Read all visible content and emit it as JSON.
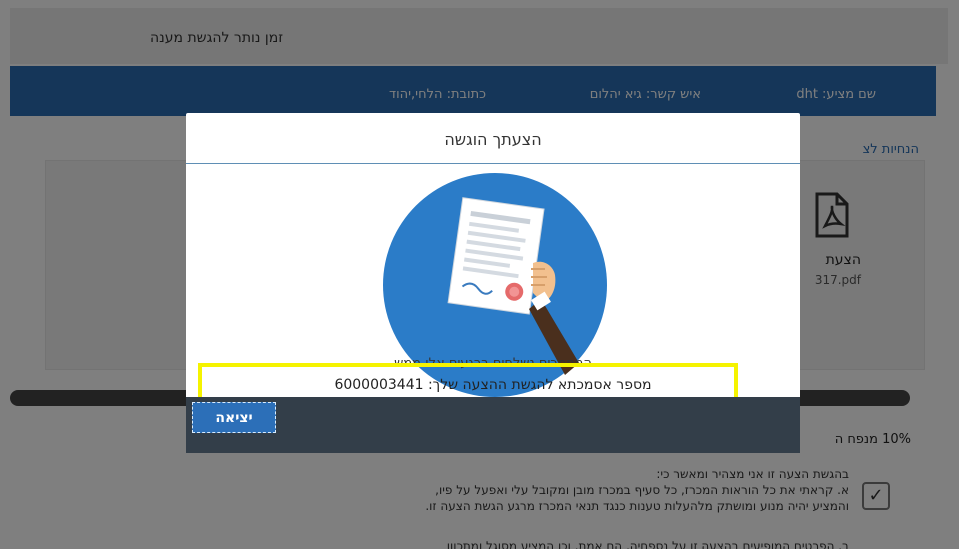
{
  "header": {
    "time_remaining_label": "זמן נותר להגשת מענה"
  },
  "supplier_bar": {
    "name": "שם מציע: dht",
    "contact": "איש קשר: גיא יהלום",
    "address": "כתובת: הלחי,יהוד"
  },
  "background": {
    "instructions_link": "הנחיות לצ",
    "document_title": "הצעת",
    "document_file": "317.pdf",
    "mafteach_label": "10% מנפח ה",
    "declaration": {
      "intro": "בהגשת הצעה זו אני מצהיר ומאשר כי:",
      "line_a": "א. קראתי את כל הוראות המכרז, כל סעיף במכרז מובן ומקובל עלי ואפעל על פיו,",
      "line_a2": "והמציע יהיה מנוע ומושתק מלהעלות טענות כנגד תנאי המכרז מרגע הגשת הצעה זו.",
      "line_b": "ב. הפרטים המופיעים בהצעה זו על נספחיה, הם אמת, וכן המציע מסוגל ומתכוון"
    },
    "checkbox_mark": "✓"
  },
  "modal": {
    "title": "הצעתך הוגשה",
    "subtitle": "המסמכים נשלחים ברגעים אלו ממש",
    "reference_text": "מספר אסמכתא להגשת ההצעה שלך: 6000003441",
    "exit_button": "יציאה",
    "illustration_icon": "signed-document-hand-icon"
  },
  "colors": {
    "accent_blue": "#2a6db3",
    "footer_dark": "#333e49",
    "highlight_yellow": "#f5f300",
    "illustration_circle": "#2b7cc8"
  }
}
